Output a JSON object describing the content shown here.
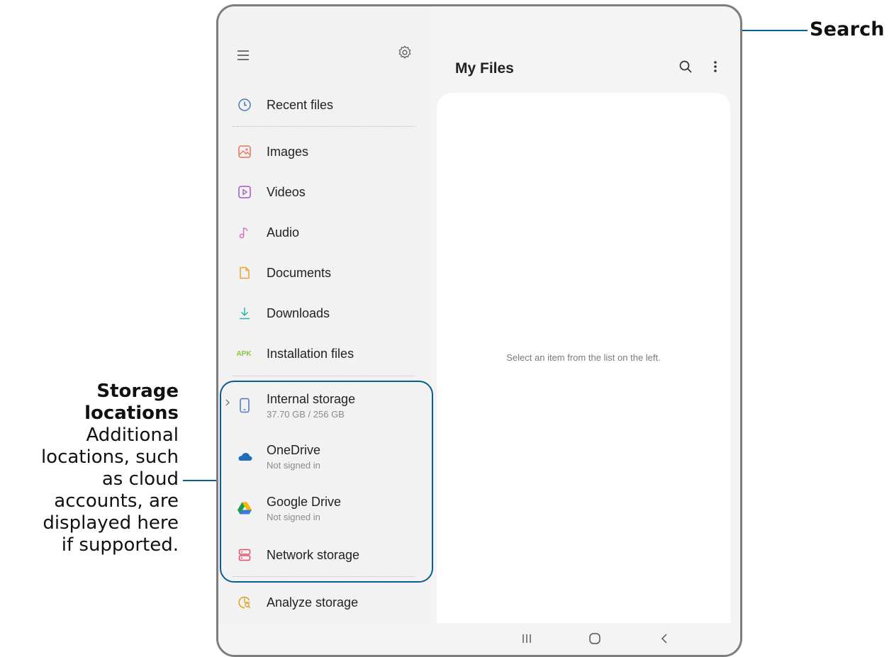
{
  "callouts": {
    "search": "Search",
    "storage_title_1": "Storage",
    "storage_title_2": "locations",
    "storage_lines": [
      "Additional",
      "locations, such",
      "as cloud",
      "accounts, are",
      "displayed here",
      "if supported."
    ]
  },
  "header": {
    "title": "My Files"
  },
  "sidebar": {
    "items": [
      {
        "label": "Recent files",
        "icon": "clock-icon"
      },
      {
        "label": "Images",
        "icon": "image-icon"
      },
      {
        "label": "Videos",
        "icon": "video-icon"
      },
      {
        "label": "Audio",
        "icon": "music-note-icon"
      },
      {
        "label": "Documents",
        "icon": "document-icon"
      },
      {
        "label": "Downloads",
        "icon": "download-icon"
      },
      {
        "label": "Installation files",
        "icon": "apk-icon",
        "icon_text": "APK"
      }
    ],
    "storage": [
      {
        "label": "Internal storage",
        "sub": "37.70 GB / 256 GB",
        "icon": "phone-icon"
      },
      {
        "label": "OneDrive",
        "sub": "Not signed in",
        "icon": "onedrive-cloud-icon"
      },
      {
        "label": "Google Drive",
        "sub": "Not signed in",
        "icon": "google-drive-icon"
      },
      {
        "label": "Network storage",
        "icon": "network-storage-icon"
      }
    ],
    "analyze": {
      "label": "Analyze storage",
      "icon": "analyze-storage-icon"
    }
  },
  "content": {
    "empty_message": "Select an item from the list on the left."
  },
  "colors": {
    "accent": "#0a5d8f",
    "images": "#e8735c",
    "videos": "#9b59c4",
    "audio": "#d46cc0",
    "documents": "#f0a030",
    "downloads": "#2bb3a6",
    "apk": "#8cc63f",
    "network": "#e84a5f",
    "analyze": "#e0a020"
  }
}
